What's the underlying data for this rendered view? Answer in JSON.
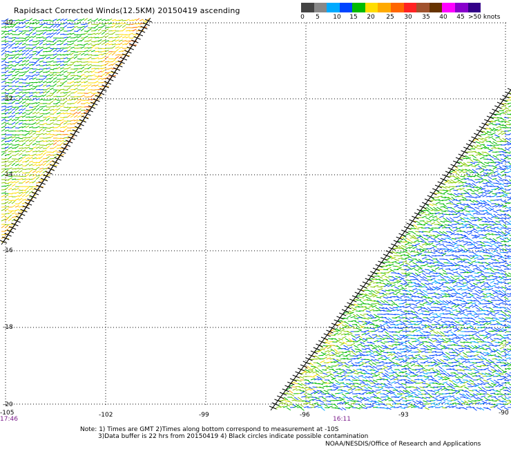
{
  "title": "Rapidsact Corrected Winds(12.5KM) 20150419 ascending",
  "legend": {
    "colors": [
      "#444444",
      "#888888",
      "#00aaff",
      "#0044ff",
      "#00bb00",
      "#ffdd00",
      "#ffaa00",
      "#ff6600",
      "#ff2222",
      "#a0522d",
      "#663300",
      "#ff00ff",
      "#8800cc",
      "#330088"
    ],
    "labels": [
      "0",
      "5",
      "10",
      "15",
      "20",
      "25",
      "30",
      "35",
      "40",
      "45",
      ">50 knots"
    ]
  },
  "axes": {
    "y_labels": [
      "-10",
      "-12",
      "-14",
      "-16",
      "-18",
      "-20"
    ],
    "x_labels": [
      "-105",
      "-102",
      "-99",
      "-96",
      "-93",
      "-90"
    ],
    "time_labels": [
      "17:46",
      "16:11"
    ]
  },
  "notes": [
    "Note: 1) Times are GMT 2)Times along bottom correspond to measurement at -10S",
    "3)Data buffer is 22 hrs from 20150419 4) Black circles indicate possible contamination"
  ],
  "credit": "NOAA/NESDIS/Office of Research and Applications"
}
